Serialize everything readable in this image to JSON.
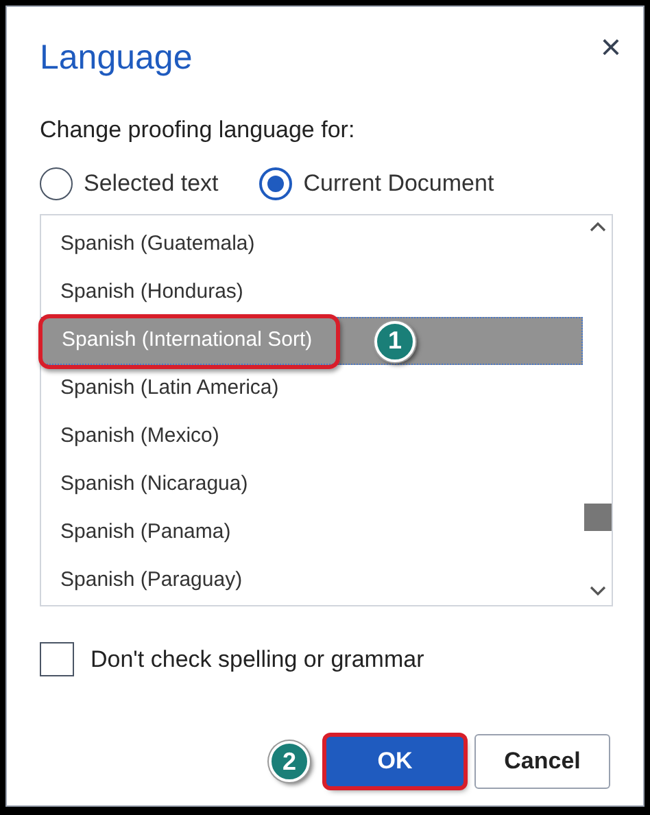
{
  "window": {
    "title": "Language",
    "close": "×"
  },
  "scope": {
    "label": "Change proofing language for:",
    "options": [
      {
        "label": "Selected text",
        "selected": false
      },
      {
        "label": "Current Document",
        "selected": true
      }
    ]
  },
  "languages": [
    {
      "label": "Spanish (Guatemala)",
      "selected": false
    },
    {
      "label": "Spanish (Honduras)",
      "selected": false
    },
    {
      "label": "Spanish (International Sort)",
      "selected": true
    },
    {
      "label": "Spanish (Latin America)",
      "selected": false
    },
    {
      "label": "Spanish (Mexico)",
      "selected": false
    },
    {
      "label": "Spanish (Nicaragua)",
      "selected": false
    },
    {
      "label": "Spanish (Panama)",
      "selected": false
    },
    {
      "label": "Spanish (Paraguay)",
      "selected": false
    }
  ],
  "dont_check": {
    "label": "Don't check spelling or grammar",
    "checked": false
  },
  "buttons": [
    {
      "label": "OK",
      "kind": "primary"
    },
    {
      "label": "Cancel",
      "kind": "secondary"
    }
  ],
  "annotations": [
    {
      "label": "1",
      "kind": "list"
    },
    {
      "label": "2",
      "kind": "button"
    }
  ]
}
